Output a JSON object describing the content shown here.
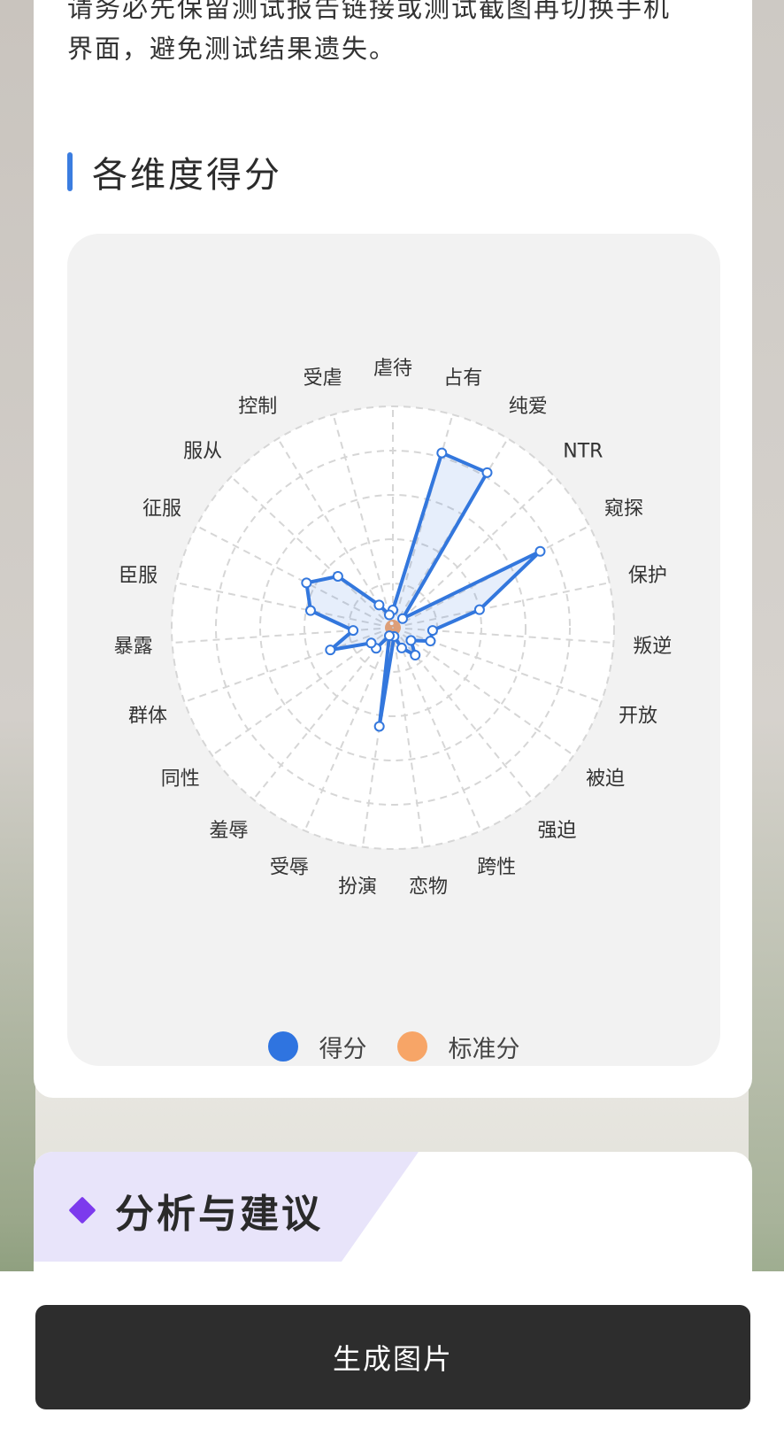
{
  "notice": {
    "line1": "请务必先保留测试报告链接或测试截图再切换手机",
    "line2": "界面，避免测试结果遗失。"
  },
  "section": {
    "title": "各维度得分"
  },
  "chart_data": {
    "type": "radar",
    "max": 100,
    "rings": 5,
    "categories": [
      "虐待",
      "占有",
      "纯爱",
      "NTR",
      "窥探",
      "保护",
      "叛逆",
      "开放",
      "被迫",
      "强迫",
      "跨性",
      "恋物",
      "扮演",
      "受辱",
      "羞辱",
      "同性",
      "群体",
      "暴露",
      "臣服",
      "征服",
      "服从",
      "控制",
      "受虐"
    ],
    "series": [
      {
        "name": "得分",
        "color": "#3377dd",
        "values": [
          8,
          82,
          82,
          6,
          75,
          40,
          18,
          18,
          10,
          16,
          10,
          4,
          45,
          4,
          12,
          12,
          30,
          18,
          38,
          44,
          34,
          12,
          6
        ]
      },
      {
        "name": "标准分",
        "color": "#f5a56b",
        "values": [
          2,
          2,
          2,
          2,
          2,
          2,
          2,
          2,
          2,
          2,
          2,
          2,
          2,
          2,
          2,
          2,
          2,
          2,
          2,
          2,
          2,
          2,
          2
        ]
      }
    ]
  },
  "legend": {
    "score_label": "得分",
    "standard_label": "标准分",
    "score_color": "#2f74e0",
    "standard_color": "#f7a567"
  },
  "analysis": {
    "title": "分析与建议"
  },
  "action": {
    "generate_label": "生成图片"
  }
}
